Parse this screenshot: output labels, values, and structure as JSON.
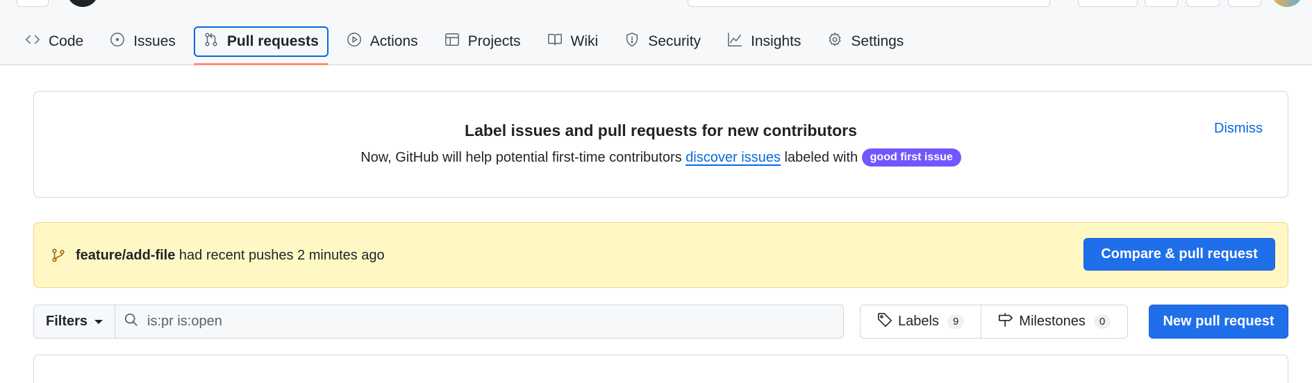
{
  "header": {
    "tabs": [
      {
        "label": "Code",
        "icon": "code-icon"
      },
      {
        "label": "Issues",
        "icon": "issue-opened-icon"
      },
      {
        "label": "Pull requests",
        "icon": "git-pull-request-icon",
        "active": true
      },
      {
        "label": "Actions",
        "icon": "play-icon"
      },
      {
        "label": "Projects",
        "icon": "table-icon"
      },
      {
        "label": "Wiki",
        "icon": "book-icon"
      },
      {
        "label": "Security",
        "icon": "shield-icon"
      },
      {
        "label": "Insights",
        "icon": "graph-icon"
      },
      {
        "label": "Settings",
        "icon": "gear-icon"
      }
    ]
  },
  "banner": {
    "title": "Label issues and pull requests for new contributors",
    "text_before": "Now, GitHub will help potential first-time contributors",
    "link": "discover issues",
    "text_after": "labeled with",
    "label_pill": "good first issue",
    "dismiss": "Dismiss"
  },
  "push": {
    "branch": "feature/add-file",
    "message": "had recent pushes 2 minutes ago",
    "button": "Compare & pull request"
  },
  "filters": {
    "button": "Filters",
    "search_value": "is:pr is:open"
  },
  "labels": {
    "label": "Labels",
    "count": "9"
  },
  "milestones": {
    "label": "Milestones",
    "count": "0"
  },
  "new_pr_button": "New pull request",
  "colors": {
    "accent": "#0969da",
    "primary_button": "#1f6feb",
    "active_tab_underline": "#fd8c73",
    "push_banner_bg": "#fff8c5",
    "good_first_issue": "#7057ff"
  }
}
